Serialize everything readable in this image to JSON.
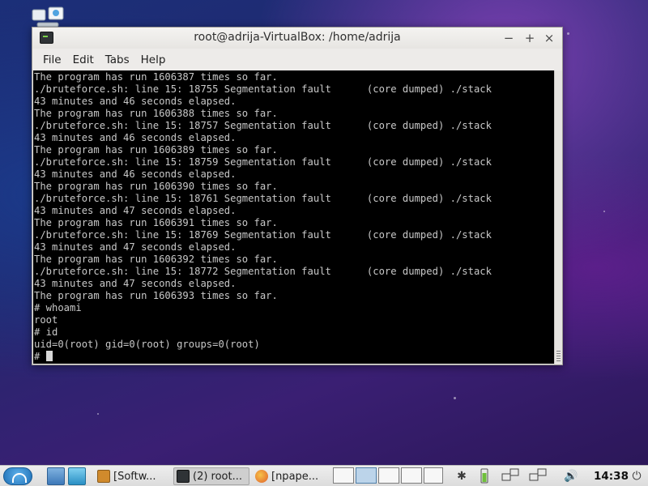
{
  "window": {
    "title": "root@adrija-VirtualBox: /home/adrija",
    "minimize_glyph": "−",
    "maximize_glyph": "+",
    "close_glyph": "×"
  },
  "menu": [
    "File",
    "Edit",
    "Tabs",
    "Help"
  ],
  "terminal": {
    "lines": [
      "The program has run 1606387 times so far.",
      "./bruteforce.sh: line 15: 18755 Segmentation fault      (core dumped) ./stack",
      "43 minutes and 46 seconds elapsed.",
      "The program has run 1606388 times so far.",
      "./bruteforce.sh: line 15: 18757 Segmentation fault      (core dumped) ./stack",
      "43 minutes and 46 seconds elapsed.",
      "The program has run 1606389 times so far.",
      "./bruteforce.sh: line 15: 18759 Segmentation fault      (core dumped) ./stack",
      "43 minutes and 46 seconds elapsed.",
      "The program has run 1606390 times so far.",
      "./bruteforce.sh: line 15: 18761 Segmentation fault      (core dumped) ./stack",
      "43 minutes and 47 seconds elapsed.",
      "The program has run 1606391 times so far.",
      "./bruteforce.sh: line 15: 18769 Segmentation fault      (core dumped) ./stack",
      "43 minutes and 47 seconds elapsed.",
      "The program has run 1606392 times so far.",
      "./bruteforce.sh: line 15: 18772 Segmentation fault      (core dumped) ./stack",
      "43 minutes and 47 seconds elapsed.",
      "The program has run 1606393 times so far.",
      "# whoami",
      "root",
      "# id",
      "uid=0(root) gid=0(root) groups=0(root)"
    ],
    "prompt": "# "
  },
  "taskbar": {
    "tasks": [
      {
        "label": "[Softw...",
        "icon": "package-icon",
        "color": "#d08a2c"
      },
      {
        "label": "(2) root...",
        "icon": "terminal-icon",
        "color": "#2f3336"
      },
      {
        "label": "[npape...",
        "icon": "firefox-icon",
        "color": "#e0602a"
      }
    ],
    "clock": "14:38",
    "tray": {
      "bluetooth": "✱",
      "volume": "🔊",
      "power": "⏻"
    },
    "colors": {
      "accent": "#1e6fb6",
      "terminal_bg": "#000000",
      "terminal_fg": "#c8c8c8"
    }
  }
}
